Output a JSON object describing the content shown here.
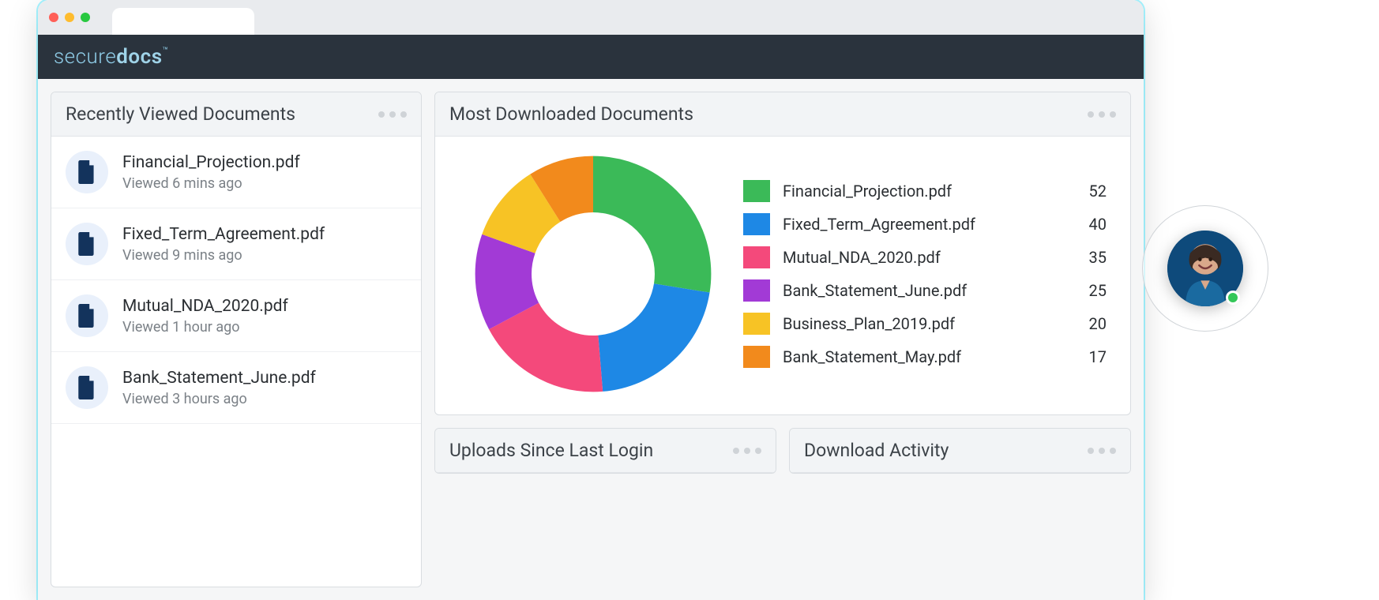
{
  "brand": {
    "part1": "secure",
    "part2": "docs",
    "tm": "™"
  },
  "panels": {
    "recent": {
      "title": "Recently Viewed Documents",
      "items": [
        {
          "name": "Financial_Projection.pdf",
          "sub": "Viewed 6 mins ago"
        },
        {
          "name": "Fixed_Term_Agreement.pdf",
          "sub": "Viewed 9 mins ago"
        },
        {
          "name": "Mutual_NDA_2020.pdf",
          "sub": "Viewed 1 hour ago"
        },
        {
          "name": "Bank_Statement_June.pdf",
          "sub": "Viewed 3 hours ago"
        }
      ]
    },
    "downloaded": {
      "title": "Most Downloaded Documents",
      "legend": [
        {
          "label": "Financial_Projection.pdf",
          "value": 52,
          "color": "#3bba58"
        },
        {
          "label": "Fixed_Term_Agreement.pdf",
          "value": 40,
          "color": "#1e88e5"
        },
        {
          "label": "Mutual_NDA_2020.pdf",
          "value": 35,
          "color": "#f4497b"
        },
        {
          "label": "Bank_Statement_June.pdf",
          "value": 25,
          "color": "#a23ad6"
        },
        {
          "label": "Business_Plan_2019.pdf",
          "value": 20,
          "color": "#f7c325"
        },
        {
          "label": "Bank_Statement_May.pdf",
          "value": 17,
          "color": "#f28a1c"
        }
      ]
    },
    "uploads": {
      "title": "Uploads Since Last Login"
    },
    "activity": {
      "title": "Download Activity"
    }
  },
  "chart_data": {
    "type": "pie",
    "title": "Most Downloaded Documents",
    "categories": [
      "Financial_Projection.pdf",
      "Fixed_Term_Agreement.pdf",
      "Mutual_NDA_2020.pdf",
      "Bank_Statement_June.pdf",
      "Business_Plan_2019.pdf",
      "Bank_Statement_May.pdf"
    ],
    "values": [
      52,
      40,
      35,
      25,
      20,
      17
    ],
    "colors": [
      "#3bba58",
      "#1e88e5",
      "#f4497b",
      "#a23ad6",
      "#f7c325",
      "#f28a1c"
    ]
  }
}
